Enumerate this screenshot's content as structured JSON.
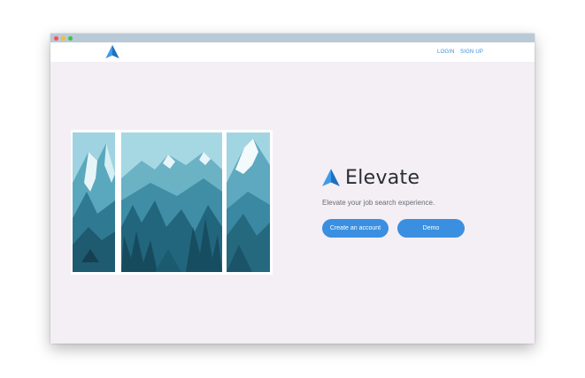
{
  "nav": {
    "login": "LOGIN",
    "signup": "SIGN UP",
    "logo_icon": "arrow-up-icon"
  },
  "hero": {
    "brand_name": "Elevate",
    "tagline": "Elevate your job search experience.",
    "create_account_label": "Create an account",
    "demo_label": "Demo",
    "illustration": "mountain-landscape-triptych"
  },
  "colors": {
    "accent": "#3a8fe0",
    "nav_link": "#3b8fd6",
    "page_bg": "#f3eff5",
    "titlebar": "#b9c9d7"
  }
}
